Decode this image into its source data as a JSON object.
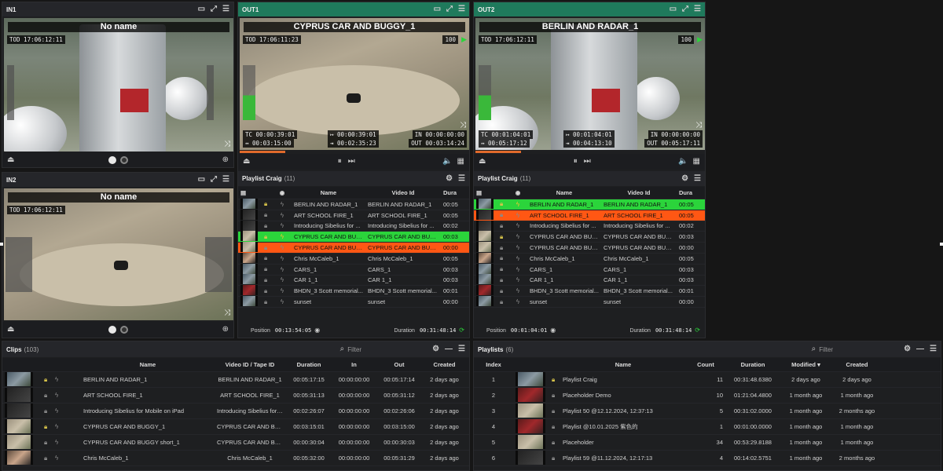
{
  "in1": {
    "label": "IN1",
    "title": "No name",
    "tod": "TOD 17:06:12:11"
  },
  "in2": {
    "label": "IN2",
    "title": "No name",
    "tod": "TOD 17:06:12:11"
  },
  "out1": {
    "label": "OUT1",
    "title": "CYPRUS CAR AND BUGGY_1",
    "tod": "TOD 17:06:11:23",
    "volume": "100",
    "tc": "TC 00:00:39:01",
    "remain": "↔ 00:03:15:00",
    "elapsed": "↦ 00:00:39:01",
    "end": "⇥ 00:02:35:23",
    "in_tc": "IN 00:00:00:00",
    "out_tc": "OUT 00:03:14:24",
    "progress": 0.2,
    "playlist_title": "Playlist Craig",
    "playlist_count": "(11)",
    "position_label": "Position",
    "position": "00:13:54:05",
    "duration_label": "Duration",
    "duration": "00:31:48:14"
  },
  "out2": {
    "label": "OUT2",
    "title": "BERLIN AND RADAR_1",
    "tod": "TOD 17:06:12:11",
    "volume": "100",
    "tc": "TC 00:01:04:01",
    "remain": "↔ 00:05:17:12",
    "elapsed": "↦ 00:01:04:01",
    "end": "⇥ 00:04:13:10",
    "in_tc": "IN 00:00:00:00",
    "out_tc": "OUT 00:05:17:11",
    "progress": 0.2,
    "playlist_title": "Playlist Craig",
    "playlist_count": "(11)",
    "position_label": "Position",
    "position": "00:01:04:01",
    "duration_label": "Duration",
    "duration": "00:31:48:14"
  },
  "playlist_columns": {
    "name": "Name",
    "video_id": "Video Id",
    "duration": "Dura"
  },
  "out1_rows": [
    {
      "name": "BERLIN AND RADAR_1",
      "video_id": "BERLIN AND RADAR_1",
      "dur": "00:05",
      "state": "",
      "locked": true
    },
    {
      "name": "ART SCHOOL FIRE_1",
      "video_id": "ART SCHOOL FIRE_1",
      "dur": "00:05",
      "state": "",
      "locked": false
    },
    {
      "name": "Introducing Sibelius for ...",
      "video_id": "Introducing Sibelius for ...",
      "dur": "00:02",
      "state": "",
      "locked": false
    },
    {
      "name": "CYPRUS CAR AND BUG...",
      "video_id": "CYPRUS CAR AND BUG...",
      "dur": "00:03",
      "state": "green",
      "locked": true
    },
    {
      "name": "CYPRUS CAR AND BUG...",
      "video_id": "CYPRUS CAR AND BUG...",
      "dur": "00:00",
      "state": "orange",
      "locked": false
    },
    {
      "name": "Chris McCaleb_1",
      "video_id": "Chris McCaleb_1",
      "dur": "00:05",
      "state": "",
      "locked": false
    },
    {
      "name": "CARS_1",
      "video_id": "CARS_1",
      "dur": "00:03",
      "state": "",
      "locked": false
    },
    {
      "name": "CAR 1_1",
      "video_id": "CAR 1_1",
      "dur": "00:03",
      "state": "",
      "locked": false
    },
    {
      "name": "BHDN_3 Scott memorial...",
      "video_id": "BHDN_3 Scott memorial...",
      "dur": "00:01",
      "state": "",
      "locked": false
    },
    {
      "name": "sunset",
      "video_id": "sunset",
      "dur": "00:00",
      "state": "",
      "locked": false
    }
  ],
  "out2_rows": [
    {
      "name": "BERLIN AND RADAR_1",
      "video_id": "BERLIN AND RADAR_1",
      "dur": "00:05",
      "state": "green",
      "locked": true
    },
    {
      "name": "ART SCHOOL FIRE_1",
      "video_id": "ART SCHOOL FIRE_1",
      "dur": "00:05",
      "state": "orange",
      "locked": false
    },
    {
      "name": "Introducing Sibelius for ...",
      "video_id": "Introducing Sibelius for ...",
      "dur": "00:02",
      "state": "",
      "locked": false
    },
    {
      "name": "CYPRUS CAR AND BUG...",
      "video_id": "CYPRUS CAR AND BUG...",
      "dur": "00:03",
      "state": "",
      "locked": true
    },
    {
      "name": "CYPRUS CAR AND BUG...",
      "video_id": "CYPRUS CAR AND BUG...",
      "dur": "00:00",
      "state": "",
      "locked": false
    },
    {
      "name": "Chris McCaleb_1",
      "video_id": "Chris McCaleb_1",
      "dur": "00:05",
      "state": "",
      "locked": false
    },
    {
      "name": "CARS_1",
      "video_id": "CARS_1",
      "dur": "00:03",
      "state": "",
      "locked": false
    },
    {
      "name": "CAR 1_1",
      "video_id": "CAR 1_1",
      "dur": "00:03",
      "state": "",
      "locked": false
    },
    {
      "name": "BHDN_3 Scott memorial...",
      "video_id": "BHDN_3 Scott memorial...",
      "dur": "00:01",
      "state": "",
      "locked": false
    },
    {
      "name": "sunset",
      "video_id": "sunset",
      "dur": "00:00",
      "state": "",
      "locked": false
    }
  ],
  "clips": {
    "title": "Clips",
    "count": "(103)",
    "filter": "Filter",
    "columns": {
      "name": "Name",
      "video_id": "Video ID / Tape ID",
      "duration": "Duration",
      "in": "In",
      "out": "Out",
      "created": "Created"
    },
    "rows": [
      {
        "name": "BERLIN AND RADAR_1",
        "video_id": "BERLIN AND RADAR_1",
        "duration": "00:05:17:15",
        "in": "00:00:00:00",
        "out": "00:05:17:14",
        "created": "2 days ago",
        "locked": true
      },
      {
        "name": "ART SCHOOL FIRE_1",
        "video_id": "ART SCHOOL FIRE_1",
        "duration": "00:05:31:13",
        "in": "00:00:00:00",
        "out": "00:05:31:12",
        "created": "2 days ago",
        "locked": false
      },
      {
        "name": "Introducing Sibelius for Mobile on iPad",
        "video_id": "Introducing Sibelius for ...",
        "duration": "00:02:26:07",
        "in": "00:00:00:00",
        "out": "00:02:26:06",
        "created": "2 days ago",
        "locked": false
      },
      {
        "name": "CYPRUS CAR AND BUGGY_1",
        "video_id": "CYPRUS CAR AND BUGG...",
        "duration": "00:03:15:01",
        "in": "00:00:00:00",
        "out": "00:03:15:00",
        "created": "2 days ago",
        "locked": true
      },
      {
        "name": "CYPRUS CAR AND BUGGY short_1",
        "video_id": "CYPRUS CAR AND BUGG...",
        "duration": "00:00:30:04",
        "in": "00:00:00:00",
        "out": "00:00:30:03",
        "created": "2 days ago",
        "locked": false
      },
      {
        "name": "Chris McCaleb_1",
        "video_id": "Chris McCaleb_1",
        "duration": "00:05:32:00",
        "in": "00:00:00:00",
        "out": "00:05:31:29",
        "created": "2 days ago",
        "locked": false
      }
    ]
  },
  "playlists": {
    "title": "Playlists",
    "count": "(6)",
    "filter": "Filter",
    "columns": {
      "index": "Index",
      "name": "Name",
      "count": "Count",
      "duration": "Duration",
      "modified": "Modified",
      "created": "Created"
    },
    "rows": [
      {
        "index": "1",
        "name": "Playlist Craig",
        "count": "11",
        "duration": "00:31:48.6380",
        "modified": "2 days ago",
        "created": "2 days ago",
        "locked": true
      },
      {
        "index": "2",
        "name": "Placeholder Demo",
        "count": "10",
        "duration": "01:21:04.4800",
        "modified": "1 month ago",
        "created": "1 month ago",
        "locked": false
      },
      {
        "index": "3",
        "name": "Playlist 50 @12.12.2024, 12:37:13",
        "count": "5",
        "duration": "00:31:02.0000",
        "modified": "1 month ago",
        "created": "2 months ago",
        "locked": false
      },
      {
        "index": "4",
        "name": "Playlist @10.01.2025 紫色的",
        "count": "1",
        "duration": "00:01:00.0000",
        "modified": "1 month ago",
        "created": "1 month ago",
        "locked": false
      },
      {
        "index": "5",
        "name": "Placeholder",
        "count": "34",
        "duration": "00:53:29.8188",
        "modified": "1 month ago",
        "created": "1 month ago",
        "locked": false
      },
      {
        "index": "6",
        "name": "Playlist 59 @11.12.2024, 12:17:13",
        "count": "4",
        "duration": "00:14:02.5751",
        "modified": "1 month ago",
        "created": "2 months ago",
        "locked": false
      }
    ]
  },
  "icons": {
    "expand": "expand-icon",
    "menu": "menu-icon",
    "eject": "eject-icon",
    "shuffle": "shuffle-icon",
    "add": "add-icon",
    "pause": "pause-icon",
    "skip": "skip-next-icon",
    "volume": "volume-icon",
    "calendar": "calendar-icon",
    "lock": "lock-icon",
    "bolt": "bolt-icon",
    "search": "search-icon",
    "settings": "settings-icon",
    "minimize": "minimize-icon",
    "visibility": "eye-icon",
    "refresh": "refresh-icon"
  },
  "colors": {
    "active": "#2bd43b",
    "next": "#ff5714",
    "header_active": "#1f7a5c",
    "progress": "#e06a2b"
  }
}
